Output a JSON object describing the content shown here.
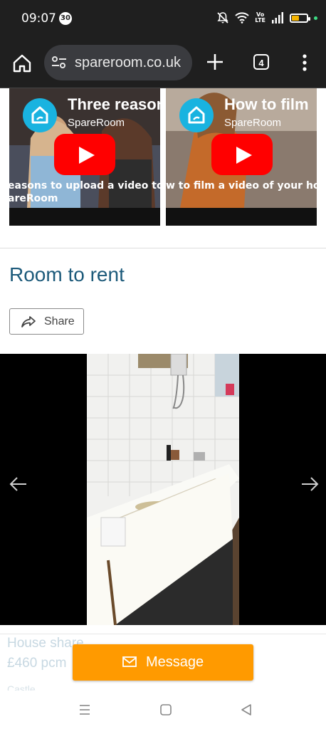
{
  "status_bar": {
    "time": "09:07",
    "notification_badge": "30",
    "volte_top": "Vo",
    "volte_bottom": "LTE",
    "icons": [
      "mute-bell-icon",
      "wifi-icon",
      "volte-icon",
      "signal-icon",
      "battery-icon"
    ],
    "battery_level": 0.45,
    "colors": {
      "battery": "#f5b400",
      "charging_dot": "#3ddc84"
    }
  },
  "browser": {
    "url": "spareroom.co.uk",
    "tab_count": "4",
    "icons": [
      "home-icon",
      "site-settings-icon",
      "new-tab-icon",
      "more-vert-icon"
    ]
  },
  "videos": [
    {
      "title": "Three reasons",
      "channel": "SpareRoom",
      "caption_line1": "easons to upload a video to",
      "caption_line2": "areRoom"
    },
    {
      "title": "How to film",
      "channel": "SpareRoom",
      "caption_line1": "w to film a video of your house",
      "caption_line2": ""
    }
  ],
  "listing": {
    "heading": "Room to rent",
    "share_label": "Share",
    "type": "House share",
    "price": "£460 pcm",
    "subline": "Castle, ... ... ..."
  },
  "gallery": {
    "prev_icon": "arrow-left-icon",
    "next_icon": "arrow-right-icon"
  },
  "message_button": {
    "label": "Message",
    "icon": "mail-icon"
  },
  "colors": {
    "heading": "#1c5a7a",
    "message_button": "#ff9a00",
    "youtube_red": "#ff0000",
    "brand_blue": "#19b3e0"
  },
  "nav_bar": {
    "icons": [
      "recents-icon",
      "home-nav-icon",
      "back-nav-icon"
    ]
  }
}
